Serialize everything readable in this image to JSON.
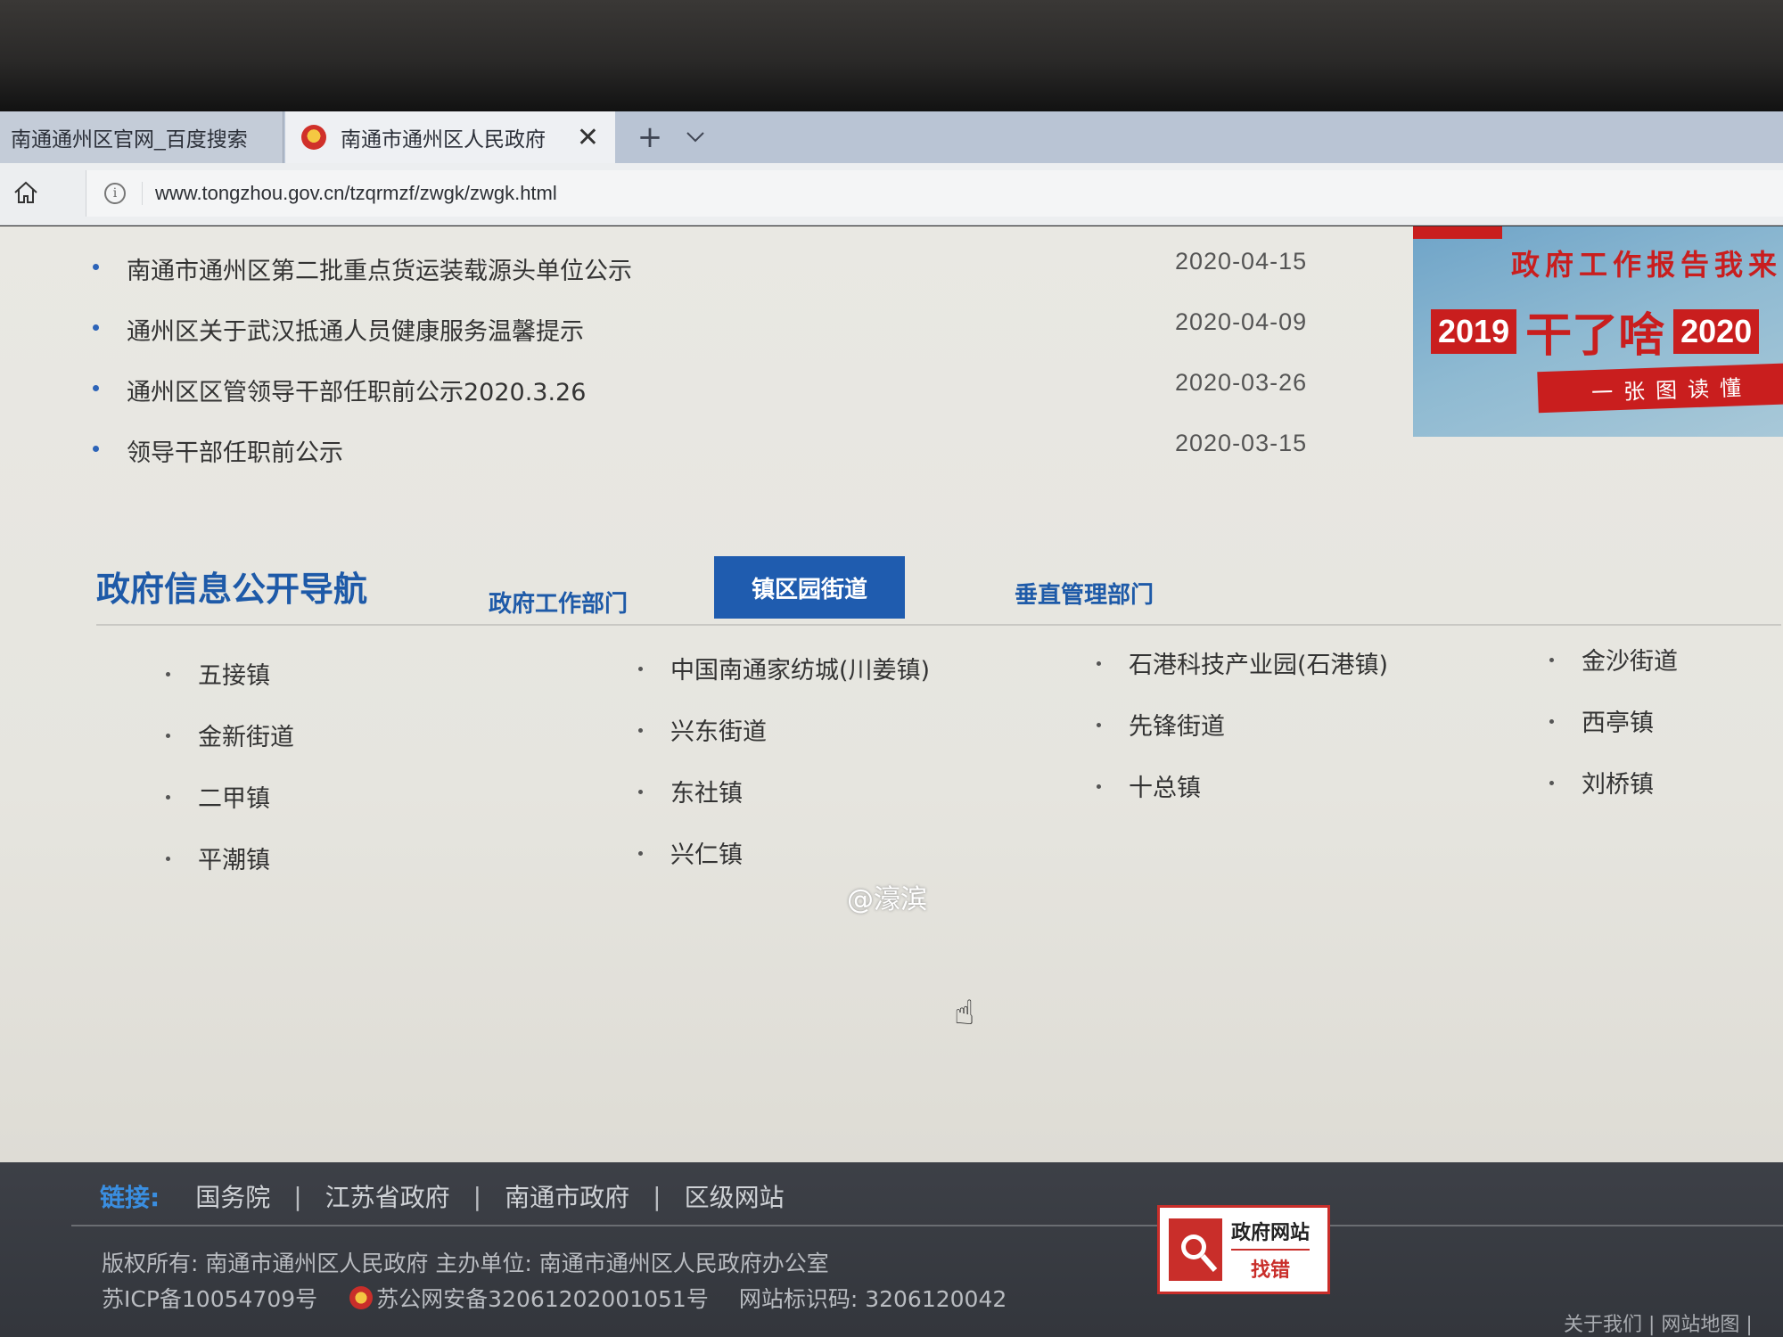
{
  "browser": {
    "tabs": [
      {
        "label": "南通通州区官网_百度搜索",
        "active": false
      },
      {
        "label": "南通市通州区人民政府",
        "active": true
      }
    ],
    "tab_close": "✕",
    "new_tab": "+",
    "url": "www.tongzhou.gov.cn/tzqrmzf/zwgk/zwgk.html"
  },
  "news": [
    {
      "title": "南通市通州区第二批重点货运装载源头单位公示",
      "date": "2020-04-15"
    },
    {
      "title": "通州区关于武汉抵通人员健康服务温馨提示",
      "date": "2020-04-09"
    },
    {
      "title": "通州区区管领导干部任职前公示2020.3.26",
      "date": "2020-03-26"
    },
    {
      "title": "领导干部任职前公示",
      "date": "2020-03-15"
    }
  ],
  "banner": {
    "line1": "政府工作报告我来",
    "year1": "2019",
    "middle": "干了啥",
    "year2": "2020",
    "line3": "一张图读懂"
  },
  "nav": {
    "heading": "政府信息公开导航",
    "tabs": [
      "政府工作部门",
      "镇区园街道",
      "垂直管理部门"
    ],
    "active_tab": "镇区园街道",
    "columns": [
      [
        "五接镇",
        "金新街道",
        "二甲镇",
        "平潮镇"
      ],
      [
        "中国南通家纺城(川姜镇)",
        "兴东街道",
        "东社镇",
        "兴仁镇"
      ],
      [
        "石港科技产业园(石港镇)",
        "先锋街道",
        "十总镇"
      ],
      [
        "金沙街道",
        "西亭镇",
        "刘桥镇"
      ]
    ]
  },
  "watermark": "@濠滨",
  "footer": {
    "links_label": "链接:",
    "links": [
      "国务院",
      "江苏省政府",
      "南通市政府",
      "区级网站"
    ],
    "copyright": "版权所有: 南通市通州区人民政府 主办单位: 南通市通州区人民政府办公室",
    "icp": "苏ICP备10054709号",
    "police": "苏公网安备32061202001051号",
    "site_id": "网站标识码: 3206120042",
    "badge_line1": "政府网站",
    "badge_line2": "找错",
    "bottom_links": "关于我们 | 网站地图 |"
  },
  "colors": {
    "accent": "#1e5aa8",
    "active_tab_bg": "#1f5caf",
    "footer_bg": "#3d4047",
    "banner_red": "#c91e1e"
  }
}
